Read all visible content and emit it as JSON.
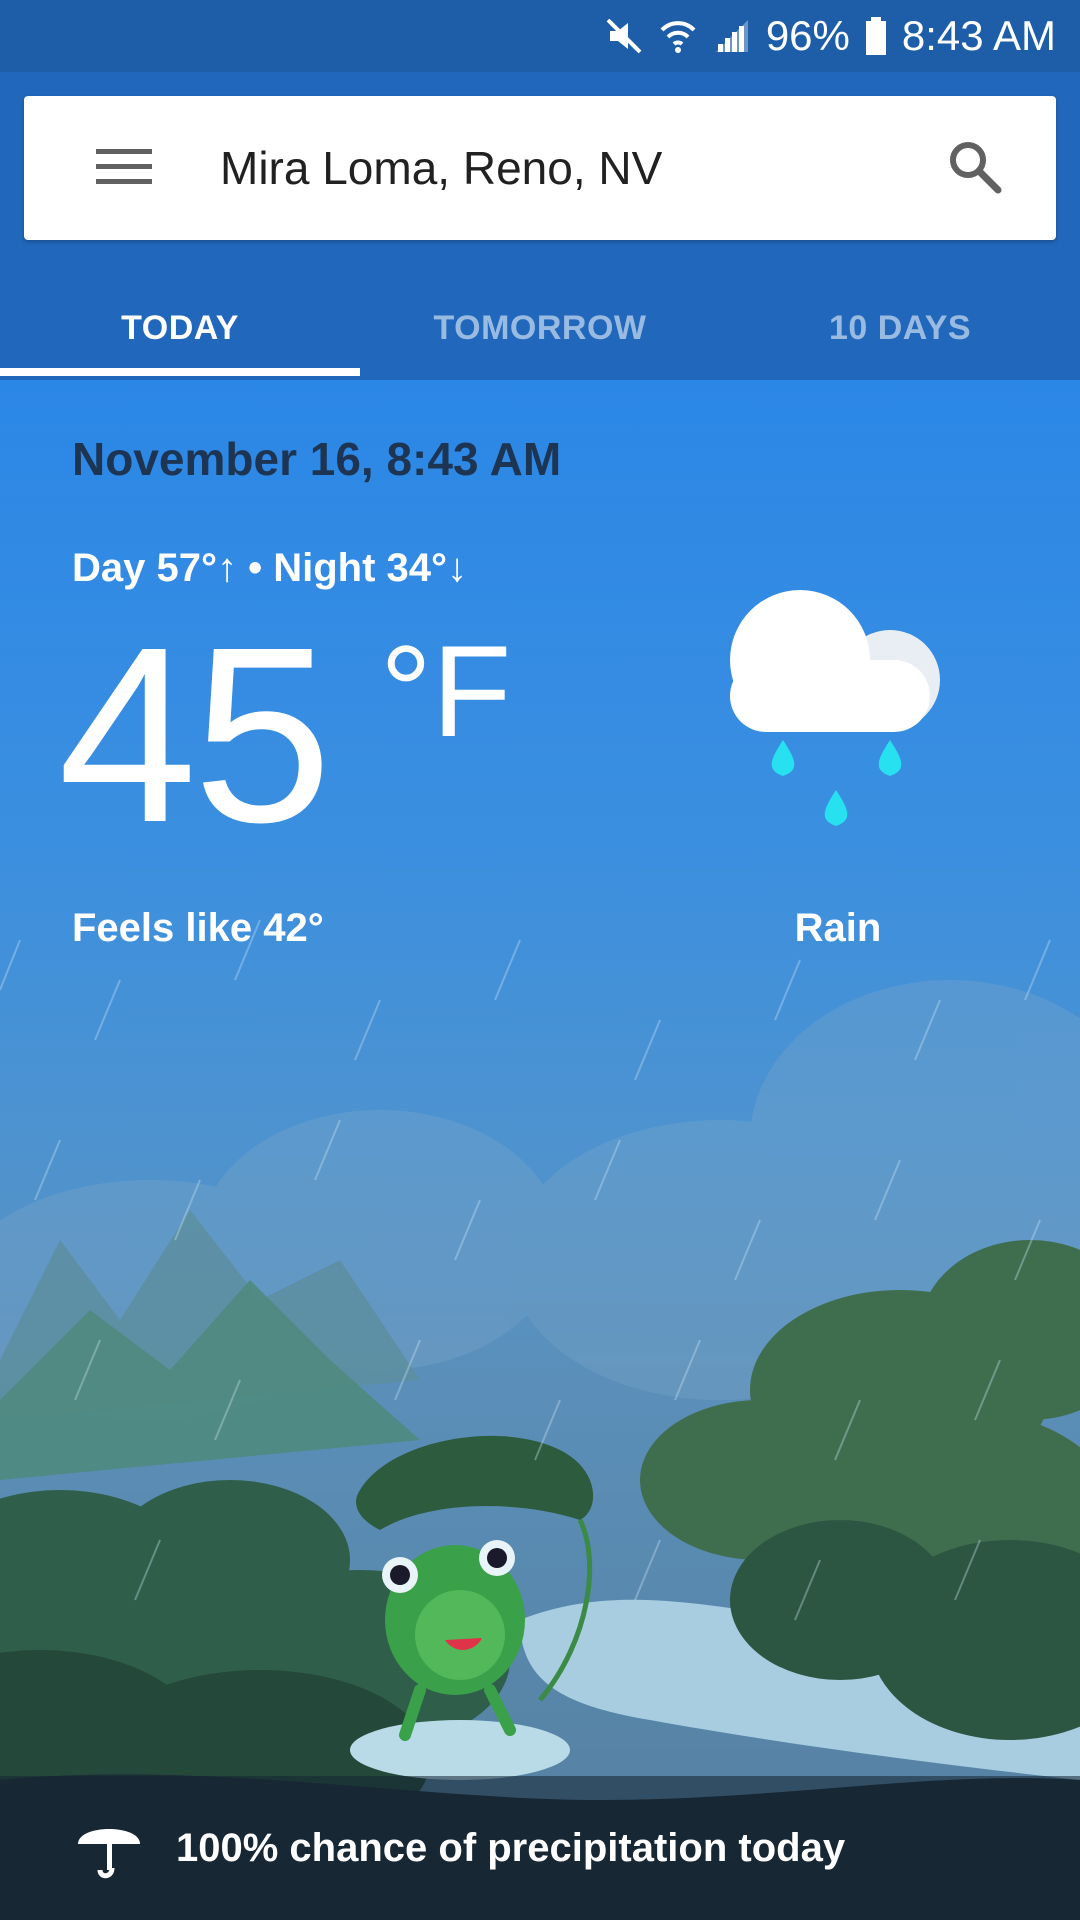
{
  "status_bar": {
    "battery": "96%",
    "time": "8:43 AM",
    "icons": [
      "mute-icon",
      "wifi-icon",
      "signal-icon",
      "battery-icon"
    ]
  },
  "search": {
    "location": "Mira Loma, Reno, NV"
  },
  "tabs": [
    {
      "label": "TODAY",
      "active": true
    },
    {
      "label": "TOMORROW",
      "active": false
    },
    {
      "label": "10 DAYS",
      "active": false
    }
  ],
  "weather": {
    "datetime": "November 16, 8:43 AM",
    "day_night": "Day 57°↑ • Night 34°↓",
    "temperature": "45",
    "unit": "°F",
    "feels_like": "Feels like 42°",
    "condition": "Rain",
    "condition_icon": "cloud-rain-icon"
  },
  "footer": {
    "precipitation": "100% chance of precipitation today",
    "icon": "umbrella-icon"
  },
  "colors": {
    "app_bar": "#2168bd",
    "status_bar": "#1e5ea8",
    "sky": "#2a86e6",
    "raindrop": "#27e0f0"
  }
}
